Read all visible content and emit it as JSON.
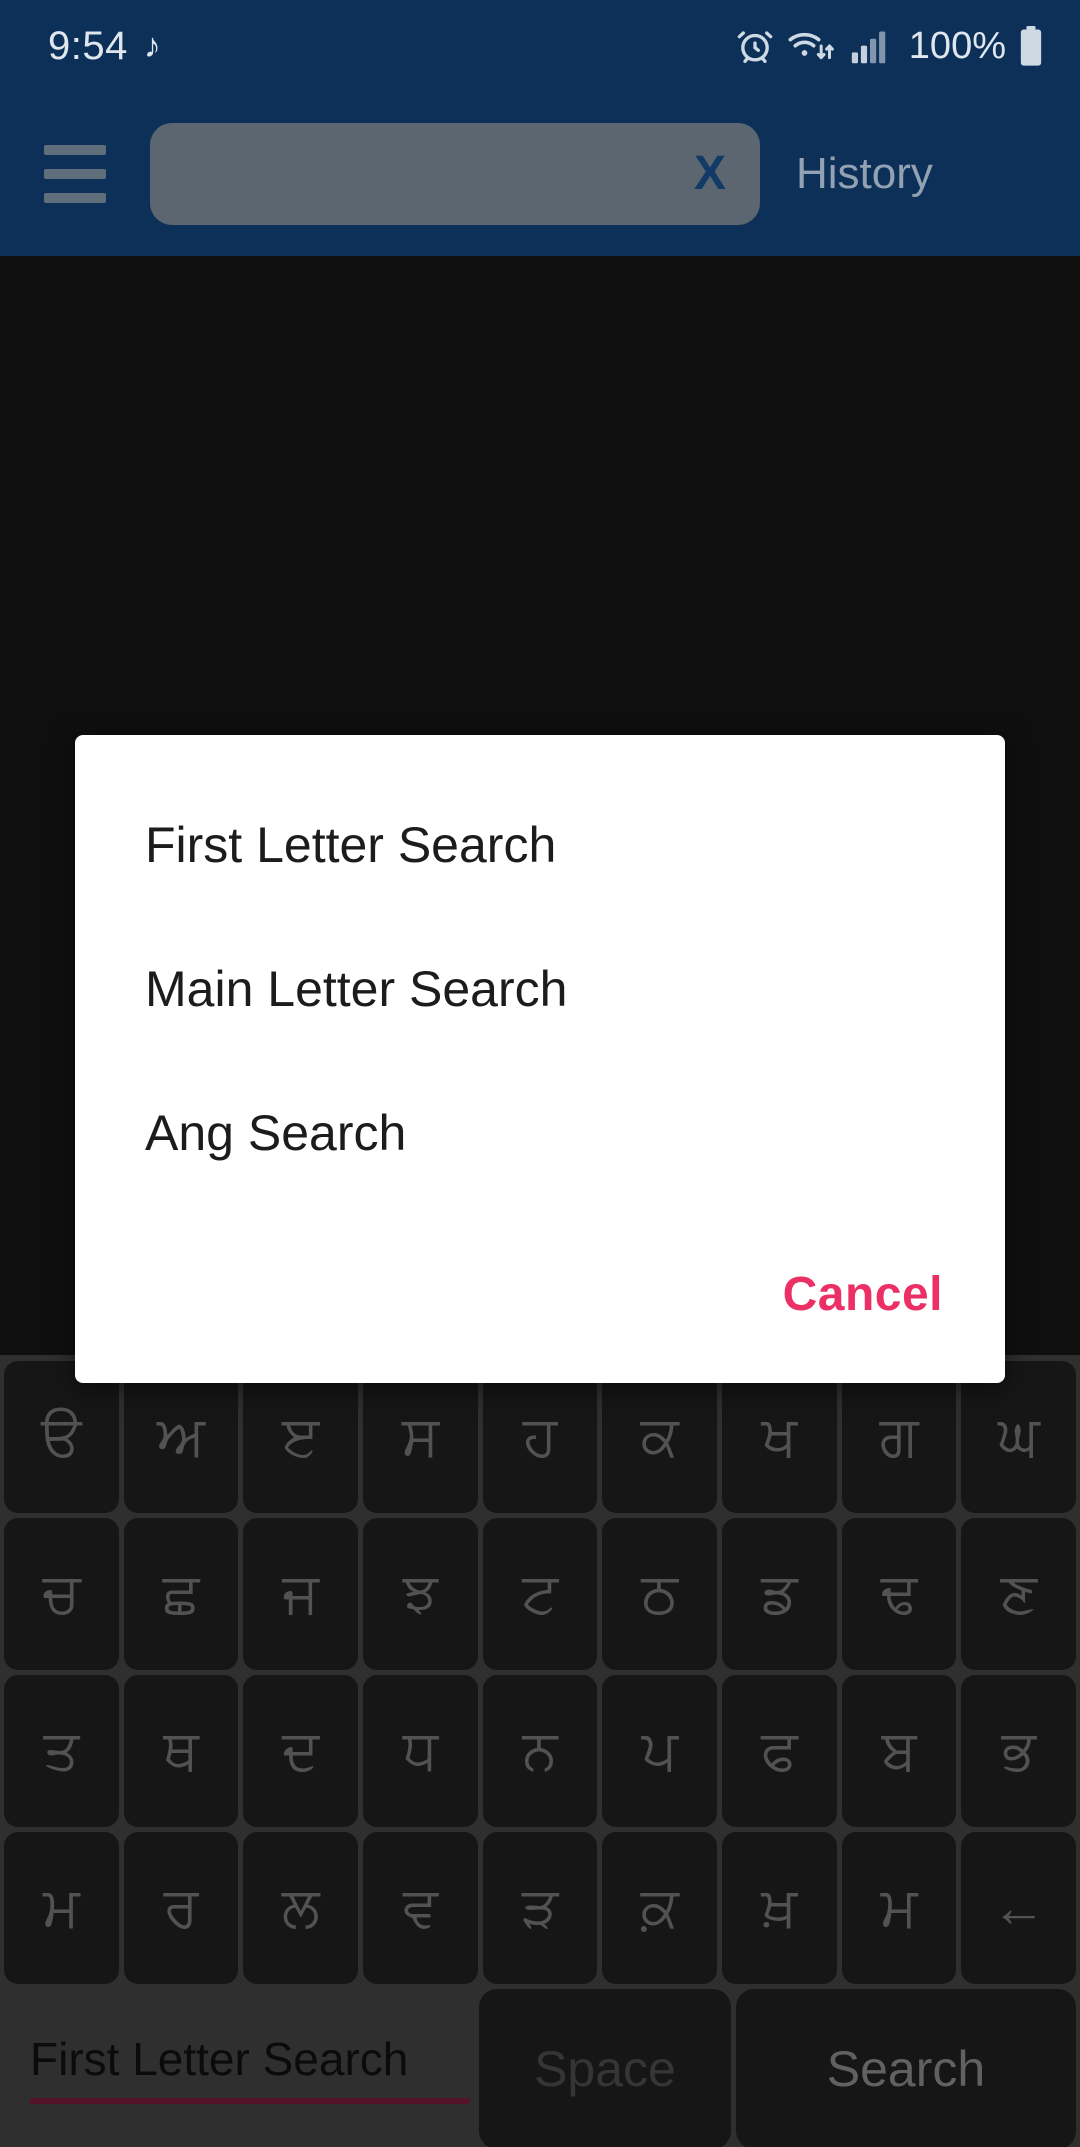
{
  "status_bar": {
    "time": "9:54",
    "music_note_icon": "music-note-icon",
    "alarm_icon": "alarm-clock-icon",
    "wifi_icon": "wifi-data-icon",
    "signal_icon": "cellular-signal-icon",
    "battery_percent": "100%",
    "battery_icon": "battery-full-icon",
    "background_color": "#0d3059"
  },
  "app_bar": {
    "menu_icon": "hamburger-menu-icon",
    "search": {
      "value": "",
      "placeholder": "",
      "clear_label": "X"
    },
    "history_label": "History",
    "background_color": "#0d3059"
  },
  "dialog": {
    "items": [
      {
        "label": "First Letter Search"
      },
      {
        "label": "Main Letter Search"
      },
      {
        "label": "Ang Search"
      }
    ],
    "cancel_label": "Cancel",
    "cancel_color": "#ec2f65",
    "background_color": "#ffffff"
  },
  "keyboard": {
    "background_color": "#515151",
    "key_color": "#262626",
    "key_text_color": "#8d8d8d",
    "rows": [
      [
        "ੳ",
        "ਅ",
        "ੲ",
        "ਸ",
        "ਹ",
        "ਕ",
        "ਖ",
        "ਗ",
        "ਘ"
      ],
      [
        "ਚ",
        "ਛ",
        "ਜ",
        "ਝ",
        "ਟ",
        "ਠ",
        "ਡ",
        "ਢ",
        "ਣ"
      ],
      [
        "ਤ",
        "ਥ",
        "ਦ",
        "ਧ",
        "ਨ",
        "ਪ",
        "ਫ",
        "ਬ",
        "ਭ"
      ],
      [
        "ਮ",
        "ਰ",
        "ਲ",
        "ਵ",
        "ੜ",
        "ਕ਼",
        "ਖ਼",
        "ਮ",
        "←"
      ]
    ],
    "bottom_row": {
      "mode_label": "First Letter Search",
      "mode_underline_color": "#8f2447",
      "space_label": "Space",
      "search_label": "Search"
    }
  }
}
